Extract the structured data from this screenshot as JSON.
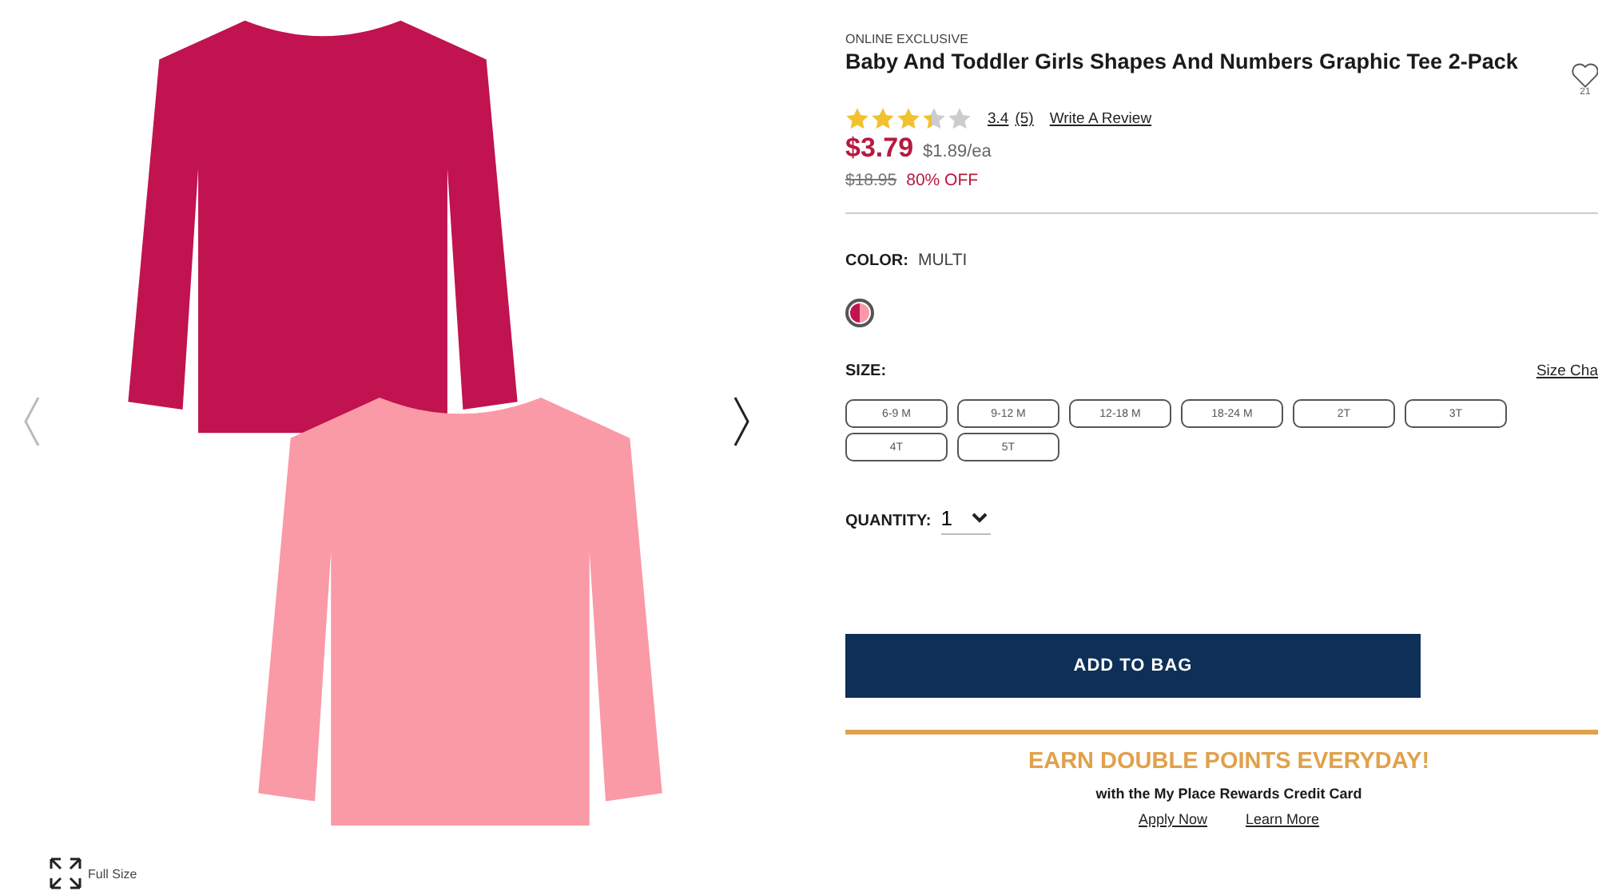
{
  "gallery": {
    "full_size_label": "Full Size"
  },
  "product": {
    "badge": "ONLINE EXCLUSIVE",
    "title": "Baby And Toddler Girls Shapes And Numbers Graphic Tee 2-Pack",
    "favorite_count": "21",
    "rating": {
      "stars": 3.4,
      "score": "3.4",
      "count": "(5)",
      "write_review": "Write A Review"
    },
    "price": {
      "current": "$3.79",
      "per_unit": "$1.89/ea",
      "original": "$18.95",
      "discount": "80% OFF"
    }
  },
  "color": {
    "label": "COLOR:",
    "value": "MULTI",
    "swatches": [
      {
        "selected": true,
        "color": "#c0134f"
      }
    ]
  },
  "size": {
    "label": "SIZE:",
    "chart_link": "Size Cha",
    "options": [
      {
        "label": "6-9 M",
        "selected": false
      },
      {
        "label": "9-12 M",
        "selected": false
      },
      {
        "label": "12-18 M",
        "selected": false
      },
      {
        "label": "18-24 M",
        "selected": false
      },
      {
        "label": "2T",
        "selected": false
      },
      {
        "label": "3T",
        "selected": false
      },
      {
        "label": "4T",
        "selected": false
      },
      {
        "label": "5T",
        "selected": false
      }
    ]
  },
  "quantity": {
    "label": "QUANTITY:",
    "value": "1"
  },
  "add_to_bag": "ADD TO BAG",
  "promo": {
    "headline": "EARN DOUBLE POINTS EVERYDAY!",
    "subline": "with the My Place Rewards Credit Card",
    "links": [
      "Apply Now",
      "Learn More"
    ]
  }
}
